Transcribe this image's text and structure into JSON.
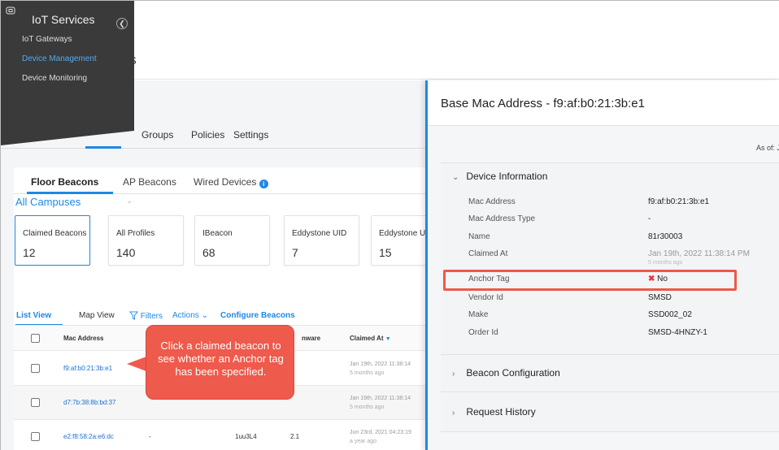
{
  "header": {
    "title_fragment": "S"
  },
  "sidebar": {
    "title": "IoT Services",
    "items": [
      {
        "label": "IoT Gateways",
        "active": false
      },
      {
        "label": "Device Management",
        "active": true
      },
      {
        "label": "Device Monitoring",
        "active": false
      }
    ]
  },
  "main_tabs": [
    "Groups",
    "Policies",
    "Settings"
  ],
  "beacon_tabs": [
    {
      "label": "Floor Beacons",
      "active": true
    },
    {
      "label": "AP Beacons",
      "active": false
    },
    {
      "label": "Wired Devices",
      "active": false,
      "info": "i"
    }
  ],
  "campus_filter": "All Campuses",
  "stat_cards": [
    {
      "label": "Claimed Beacons",
      "value": "12",
      "selected": true
    },
    {
      "label": "All Profiles",
      "value": "140",
      "selected": false
    },
    {
      "label": "IBeacon",
      "value": "68",
      "selected": false
    },
    {
      "label": "Eddystone UID",
      "value": "7",
      "selected": false
    },
    {
      "label": "Eddystone UI",
      "value": "15",
      "selected": false
    }
  ],
  "toolbar": {
    "list_view": "List View",
    "map_view": "Map View",
    "filters": "Filters",
    "actions": "Actions",
    "configure": "Configure Beacons"
  },
  "table": {
    "columns": {
      "mac": "Mac Address",
      "firmware": "nware",
      "claimed_at": "Claimed At"
    },
    "rows": [
      {
        "mac": "f9:af:b0:21:3b:e1",
        "col2": "",
        "col3": "",
        "col4": "",
        "claimed": "Jan 19th, 2022 11:38:14",
        "ago": "5 months ago"
      },
      {
        "mac": "d7:7b:38:8b:bd:37",
        "col2": "",
        "col3": "",
        "col4": "",
        "claimed": "Jan 19th, 2022 11:38:14",
        "ago": "5 months ago"
      },
      {
        "mac": "e2:f8:58:2a:e6:dc",
        "col2": "-",
        "col3": "1uu3L4",
        "col4": "2.1",
        "claimed": "Jun 23rd, 2021 04:23:19",
        "ago": "a year ago"
      }
    ]
  },
  "callout": {
    "text": "Click a claimed beacon to see whether an Anchor tag has been specified.",
    "color": "#ee5a4b"
  },
  "drawer": {
    "title": "Base Mac Address - f9:af:b0:21:3b:e1",
    "as_of": "As of: Ju",
    "sections": {
      "device_info": "Device Information",
      "beacon_config": "Beacon Configuration",
      "request_history": "Request History"
    },
    "fields": [
      {
        "label": "Mac Address",
        "value": "f9:af:b0:21:3b:e1"
      },
      {
        "label": "Mac Address Type",
        "value": "-"
      },
      {
        "label": "Name",
        "value": "81r30003"
      },
      {
        "label": "Claimed At",
        "value": "Jan 19th, 2022 11:38:14 PM",
        "sub": "5 months ago"
      },
      {
        "label": "Anchor Tag",
        "value": "No"
      },
      {
        "label": "Vendor Id",
        "value": "SMSD"
      },
      {
        "label": "Make",
        "value": "SSD002_02"
      },
      {
        "label": "Order Id",
        "value": "SMSD-4HNZY-1"
      }
    ]
  },
  "colors": {
    "accent": "#1e88e5",
    "highlight": "#ec5a47",
    "sidebar_bg": "#3a3a3a"
  }
}
